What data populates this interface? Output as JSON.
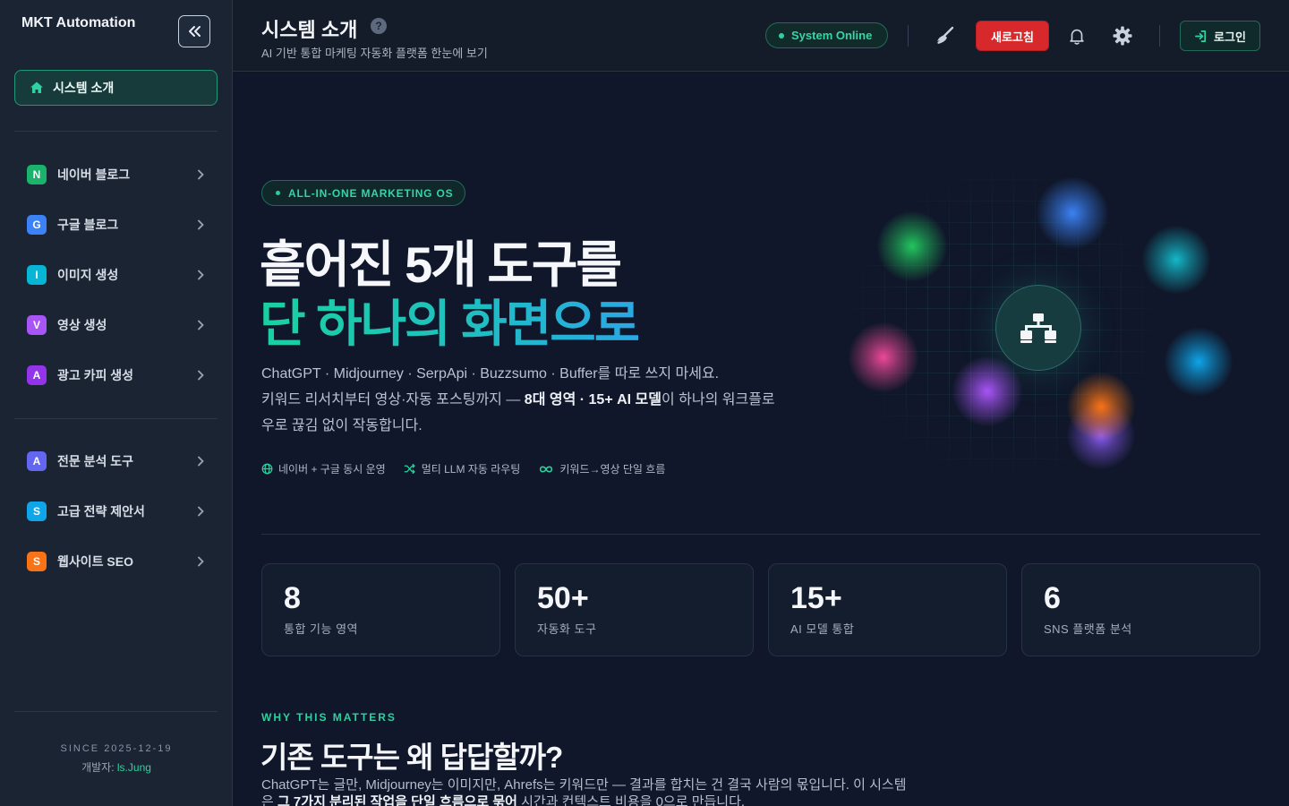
{
  "sidebar": {
    "brand": "MKT Automation",
    "home_label": "시스템 소개",
    "items": [
      {
        "badge": "N",
        "label": "네이버 블로그",
        "color": "#19b36b"
      },
      {
        "badge": "G",
        "label": "구글 블로그",
        "color": "#3b82f6"
      },
      {
        "badge": "I",
        "label": "이미지 생성",
        "color": "#06b6d4"
      },
      {
        "badge": "V",
        "label": "영상 생성",
        "color": "#a855f7"
      },
      {
        "badge": "A",
        "label": "광고 카피 생성",
        "color": "#9333ea"
      }
    ],
    "items2": [
      {
        "badge": "A",
        "label": "전문 분석 도구",
        "color": "#6366f1"
      },
      {
        "badge": "S",
        "label": "고급 전략 제안서",
        "color": "#0ea5e9"
      },
      {
        "badge": "S",
        "label": "웹사이트 SEO",
        "color": "#f97316"
      }
    ],
    "footer": {
      "since": "SINCE 2025-12-19",
      "dev_label": "개발자:",
      "dev_name": "ls.Jung"
    }
  },
  "header": {
    "title": "시스템 소개",
    "subtitle": "AI 기반 통합 마케팅 자동화 플랫폼 한눈에 보기",
    "status": "System Online",
    "refresh_label": "새로고침",
    "login_label": "로그인"
  },
  "hero": {
    "eyebrow": "ALL-IN-ONE MARKETING OS",
    "title_line1": "흩어진 5개 도구를",
    "title_line2": "단 하나의 화면으로",
    "desc_line1": "ChatGPT · Midjourney · SerpApi · Buzzsumo · Buffer를 따로 쓰지 마세요.",
    "desc_pre": "키워드 리서치부터 영상·자동 포스팅까지 — ",
    "desc_bold": "8대 영역 · 15+ AI 모델",
    "desc_post": "이 하나의 워크플로우로 끊김 없이 작동합니다.",
    "features": [
      "네이버 + 구글 동시 운영",
      "멀티 LLM 자동 라우팅",
      "키워드→영상 단일 흐름"
    ]
  },
  "stats": [
    {
      "value": "8",
      "label": "통합 기능 영역"
    },
    {
      "value": "50+",
      "label": "자동화 도구"
    },
    {
      "value": "15+",
      "label": "AI 모델 통합"
    },
    {
      "value": "6",
      "label": "SNS 플랫폼 분석"
    }
  ],
  "why": {
    "eyebrow": "WHY THIS MATTERS",
    "title": "기존 도구는 왜 답답할까?",
    "desc_pre": "ChatGPT는 글만, Midjourney는 이미지만, Ahrefs는 키워드만 — 결과를 합치는 건 결국 사람의 몫입니다. 이 시스템은 ",
    "desc_bold": "그 7가지 분리된 작업을 단일 흐름으로 묶어",
    "desc_post": " 시간과 컨텍스트 비용을 0으로 만듭니다."
  },
  "colors": {
    "accent": "#2fd1a0",
    "danger": "#d7282c"
  }
}
